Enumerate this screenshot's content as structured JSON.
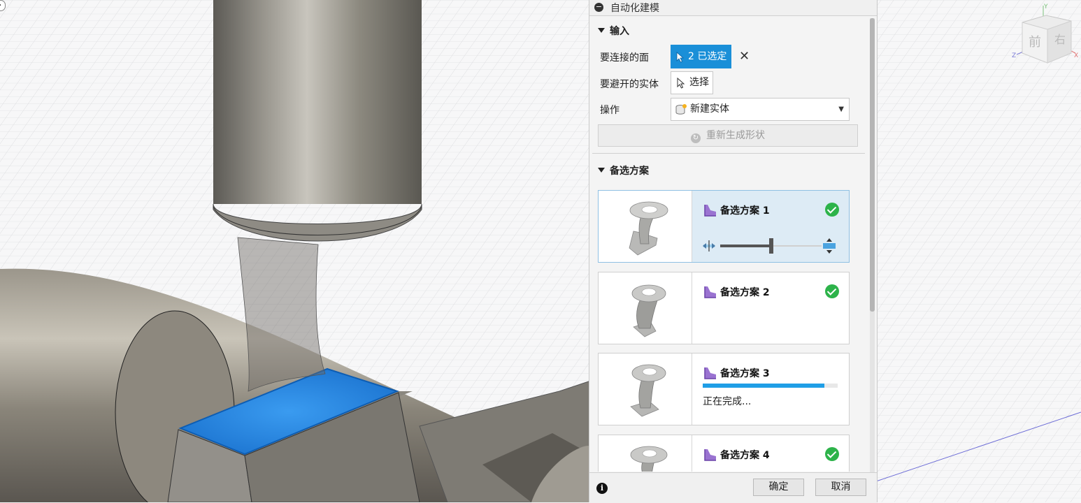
{
  "panel": {
    "title": "自动化建模",
    "input_section": {
      "heading": "输入",
      "faces_label": "要连接的面",
      "faces_button": "2 已选定",
      "avoid_label": "要避开的实体",
      "avoid_button": "选择",
      "operation_label": "操作",
      "operation_value": "新建实体",
      "regenerate_button": "重新生成形状"
    },
    "alternatives_section": {
      "heading": "备选方案",
      "items": [
        {
          "name": "备选方案 1",
          "selected": true,
          "complete": true,
          "slider_position": 0.5
        },
        {
          "name": "备选方案 2",
          "selected": false,
          "complete": true
        },
        {
          "name": "备选方案 3",
          "selected": false,
          "complete": false,
          "status": "正在完成...",
          "progress": 0.9
        },
        {
          "name": "备选方案 4",
          "selected": false,
          "complete": true
        }
      ]
    },
    "footer": {
      "ok_button": "确定",
      "cancel_button": "取消"
    }
  },
  "viewcube": {
    "front_face": "前",
    "right_face": "右",
    "axis_x": "X",
    "axis_y": "Y",
    "axis_z": "Z"
  },
  "colors": {
    "accent": "#1a8fd8",
    "selection_face": "#1e7fd9",
    "check_green": "#2db34a",
    "selected_card": "#ddebf5"
  }
}
